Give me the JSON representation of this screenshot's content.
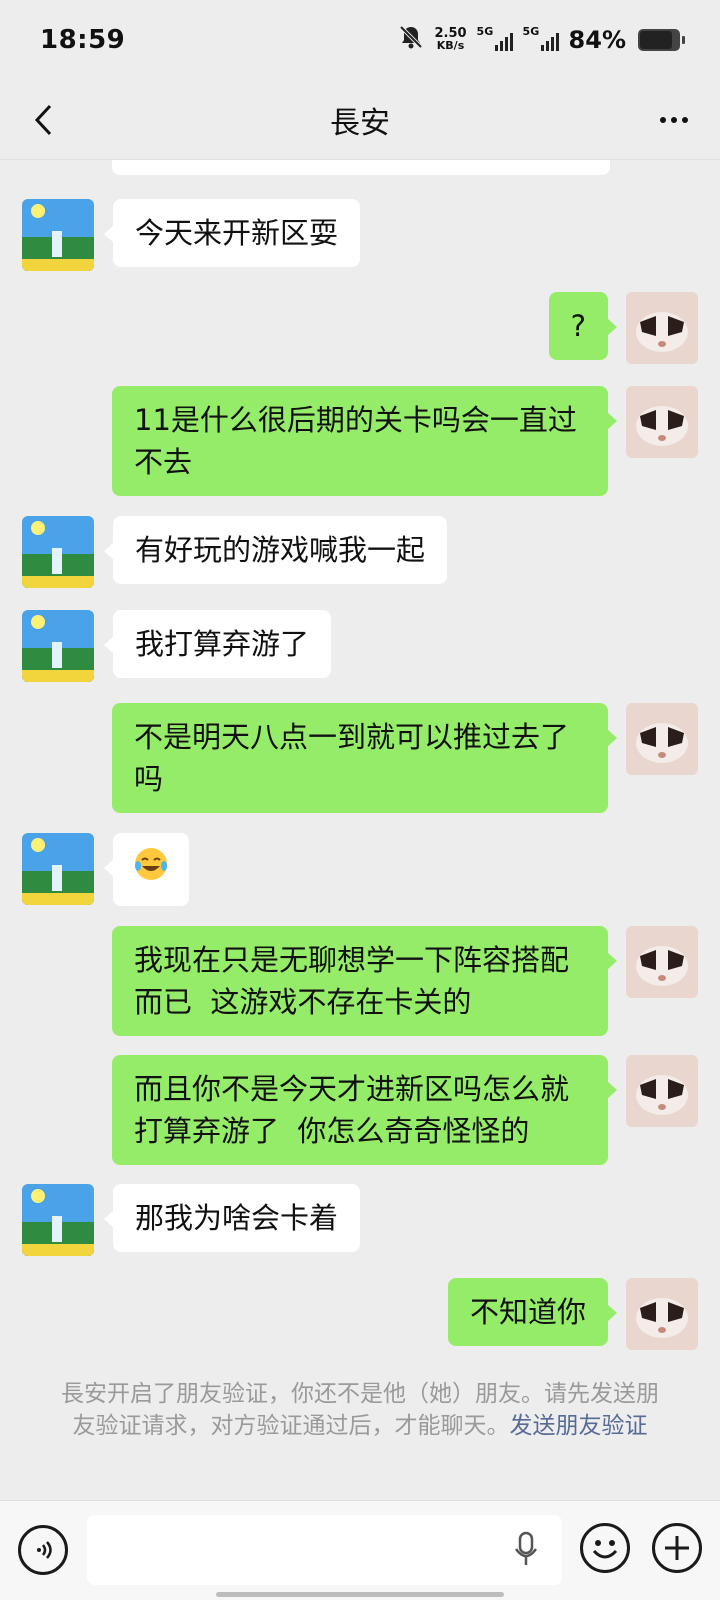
{
  "status_bar": {
    "time": "18:59",
    "speed_value": "2.50",
    "speed_unit": "KB/s",
    "signal1_label": "5G",
    "signal2_label": "5G",
    "battery": "84%",
    "icons": [
      "mute-bell-icon",
      "signal-icon",
      "battery-icon"
    ]
  },
  "header": {
    "title": "長安",
    "back_icon": "chevron-left-icon",
    "more_icon": "ellipsis-icon"
  },
  "messages": [
    {
      "side": "in",
      "text": "今天来开新区耍"
    },
    {
      "side": "out",
      "text": "?"
    },
    {
      "side": "out",
      "text": "11是什么很后期的关卡吗会一直过不去"
    },
    {
      "side": "in",
      "text": "有好玩的游戏喊我一起"
    },
    {
      "side": "in",
      "text": "我打算弃游了"
    },
    {
      "side": "out",
      "text": "不是明天八点一到就可以推过去了吗"
    },
    {
      "side": "in",
      "text": "",
      "emoji": "laughing-crying-emoji"
    },
    {
      "side": "out",
      "text": "我现在只是无聊想学一下阵容搭配而已  这游戏不存在卡关的"
    },
    {
      "side": "out",
      "text": "而且你不是今天才进新区吗怎么就打算弃游了  你怎么奇奇怪怪的"
    },
    {
      "side": "in",
      "text": "那我为啥会卡着"
    },
    {
      "side": "out",
      "text": "不知道你"
    }
  ],
  "system_notice": {
    "text": "長安开启了朋友验证，你还不是他（她）朋友。请先发送朋友验证请求，对方验证通过后，才能聊天。",
    "link": "发送朋友验证"
  },
  "input_bar": {
    "placeholder": "",
    "icons": [
      "voice-icon",
      "mic-icon",
      "emoji-icon",
      "plus-icon"
    ]
  },
  "colors": {
    "background": "#ededed",
    "outgoing_bubble": "#95ec69",
    "incoming_bubble": "#ffffff",
    "link": "#576b95"
  }
}
